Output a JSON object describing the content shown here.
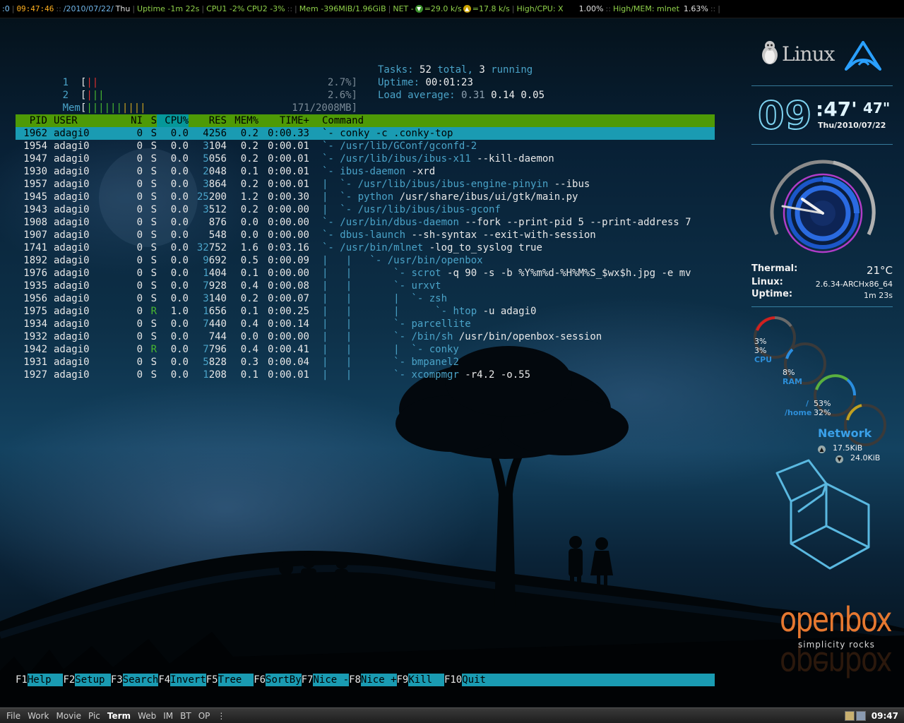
{
  "topbar": {
    "workspace": ":0",
    "time": "09:47:46",
    "date_sep": "::",
    "date": "/2010/07/22/",
    "weekday": "Thu",
    "uptime": "Uptime -1m 22s",
    "sep": "::",
    "cpu1": "CPU1 -2%",
    "cpu2": "CPU2 -3%",
    "mem": "Mem -396MiB/1.96GiB",
    "net_label": "NET -",
    "net_down": "=29.0 k/s",
    "net_up": "=17.8 k/s",
    "high_cpu": "High/CPU: X",
    "high_cpu_val": "1.00%",
    "high_mem": "High/MEM: mlnet",
    "high_mem_val": "1.63%",
    "pipe": "|",
    "seps": "::"
  },
  "htop": {
    "meters": [
      {
        "label": "1",
        "bars_red": "||",
        "bars_green": "",
        "bars_yellow": "",
        "value": "2.7%]"
      },
      {
        "label": "2",
        "bars_red": "|",
        "bars_green": "||",
        "bars_yellow": "",
        "value": "2.6%]"
      },
      {
        "label": "Mem",
        "bars_red": "",
        "bars_green": "||||||",
        "bars_yellow": "||||",
        "value": "171/2008MB]"
      }
    ],
    "tasks": {
      "label": "Tasks:",
      "total": "52",
      "total_lbl": "total,",
      "running": "3",
      "running_lbl": "running"
    },
    "uptime": {
      "label": "Uptime:",
      "value": "00:01:23"
    },
    "load": {
      "label": "Load average:",
      "v1": "0.31",
      "v2": "0.14",
      "v3": "0.05"
    },
    "headers": {
      "pid": "PID",
      "user": "USER",
      "ni": "NI",
      "s": "S",
      "cpu": "CPU%",
      "res": "RES",
      "mem": "MEM%",
      "time": "TIME+",
      "cmd": "Command"
    },
    "rows": [
      {
        "pid": "1962",
        "user": "adagi0",
        "ni": "0",
        "s": "S",
        "cpu": "0.0",
        "res_hi": "",
        "res": "4256",
        "mem": "0.2",
        "time": "0:00.33",
        "tree": "`- ",
        "base": "conky -c .conky-top",
        "rest": ""
      },
      {
        "pid": "1954",
        "user": "adagi0",
        "ni": "0",
        "s": "S",
        "cpu": "0.0",
        "res_hi": "3",
        "res": "104",
        "mem": "0.2",
        "time": "0:00.01",
        "tree": "`- ",
        "base": "/usr/lib/GConf/gconfd-2",
        "rest": ""
      },
      {
        "pid": "1947",
        "user": "adagi0",
        "ni": "0",
        "s": "S",
        "cpu": "0.0",
        "res_hi": "5",
        "res": "056",
        "mem": "0.2",
        "time": "0:00.01",
        "tree": "`- ",
        "base": "/usr/lib/ibus/ibus-x11",
        "rest": " --kill-daemon"
      },
      {
        "pid": "1930",
        "user": "adagi0",
        "ni": "0",
        "s": "S",
        "cpu": "0.0",
        "res_hi": "2",
        "res": "048",
        "mem": "0.1",
        "time": "0:00.01",
        "tree": "`- ",
        "base": "ibus-daemon",
        "rest": " -xrd"
      },
      {
        "pid": "1957",
        "user": "adagi0",
        "ni": "0",
        "s": "S",
        "cpu": "0.0",
        "res_hi": "3",
        "res": "864",
        "mem": "0.2",
        "time": "0:00.01",
        "tree": "|  `- ",
        "base": "/usr/lib/ibus/ibus-engine-pinyin",
        "rest": " --ibus"
      },
      {
        "pid": "1945",
        "user": "adagi0",
        "ni": "0",
        "s": "S",
        "cpu": "0.0",
        "res_hi": "25",
        "res": "200",
        "mem": "1.2",
        "time": "0:00.30",
        "tree": "|  `- ",
        "base": "python",
        "rest": " /usr/share/ibus/ui/gtk/main.py"
      },
      {
        "pid": "1943",
        "user": "adagi0",
        "ni": "0",
        "s": "S",
        "cpu": "0.0",
        "res_hi": "3",
        "res": "512",
        "mem": "0.2",
        "time": "0:00.00",
        "tree": "|  `- ",
        "base": "/usr/lib/ibus/ibus-gconf",
        "rest": ""
      },
      {
        "pid": "1908",
        "user": "adagi0",
        "ni": "0",
        "s": "S",
        "cpu": "0.0",
        "res_hi": "",
        "res": "876",
        "mem": "0.0",
        "time": "0:00.00",
        "tree": "`- ",
        "base": "/usr/bin/dbus-daemon",
        "rest": " --fork --print-pid 5 --print-address 7"
      },
      {
        "pid": "1907",
        "user": "adagi0",
        "ni": "0",
        "s": "S",
        "cpu": "0.0",
        "res_hi": "",
        "res": "548",
        "mem": "0.0",
        "time": "0:00.00",
        "tree": "`- ",
        "base": "dbus-launch",
        "rest": " --sh-syntax --exit-with-session"
      },
      {
        "pid": "1741",
        "user": "adagi0",
        "ni": "0",
        "s": "S",
        "cpu": "0.0",
        "res_hi": "32",
        "res": "752",
        "mem": "1.6",
        "time": "0:03.16",
        "tree": "`- ",
        "base": "/usr/bin/mlnet",
        "rest": " -log_to_syslog true"
      },
      {
        "pid": "1892",
        "user": "adagi0",
        "ni": "0",
        "s": "S",
        "cpu": "0.0",
        "res_hi": "9",
        "res": "692",
        "mem": "0.5",
        "time": "0:00.09",
        "tree": "|   |   `- ",
        "base": "/usr/bin/openbox",
        "rest": ""
      },
      {
        "pid": "1976",
        "user": "adagi0",
        "ni": "0",
        "s": "S",
        "cpu": "0.0",
        "res_hi": "1",
        "res": "404",
        "mem": "0.1",
        "time": "0:00.00",
        "tree": "|   |       `- ",
        "base": "scrot",
        "rest": " -q 90 -s -b %Y%m%d-%H%M%S_$wx$h.jpg -e mv"
      },
      {
        "pid": "1935",
        "user": "adagi0",
        "ni": "0",
        "s": "S",
        "cpu": "0.0",
        "res_hi": "7",
        "res": "928",
        "mem": "0.4",
        "time": "0:00.08",
        "tree": "|   |       `- ",
        "base": "urxvt",
        "rest": ""
      },
      {
        "pid": "1956",
        "user": "adagi0",
        "ni": "0",
        "s": "S",
        "cpu": "0.0",
        "res_hi": "3",
        "res": "140",
        "mem": "0.2",
        "time": "0:00.07",
        "tree": "|   |       |  `- ",
        "base": "zsh",
        "rest": ""
      },
      {
        "pid": "1975",
        "user": "adagi0",
        "ni": "0",
        "s": "R",
        "cpu": "1.0",
        "res_hi": "1",
        "res": "656",
        "mem": "0.1",
        "time": "0:00.25",
        "tree": "|   |       |      `- ",
        "base": "htop",
        "rest": " -u adagi0"
      },
      {
        "pid": "1934",
        "user": "adagi0",
        "ni": "0",
        "s": "S",
        "cpu": "0.0",
        "res_hi": "7",
        "res": "440",
        "mem": "0.4",
        "time": "0:00.14",
        "tree": "|   |       `- ",
        "base": "parcellite",
        "rest": ""
      },
      {
        "pid": "1932",
        "user": "adagi0",
        "ni": "0",
        "s": "S",
        "cpu": "0.0",
        "res_hi": "",
        "res": "744",
        "mem": "0.0",
        "time": "0:00.00",
        "tree": "|   |       `- ",
        "base": "/bin/sh",
        "rest": " /usr/bin/openbox-session"
      },
      {
        "pid": "1942",
        "user": "adagi0",
        "ni": "0",
        "s": "R",
        "cpu": "0.0",
        "res_hi": "7",
        "res": "796",
        "mem": "0.4",
        "time": "0:00.41",
        "tree": "|   |       |  `- ",
        "base": "conky",
        "rest": ""
      },
      {
        "pid": "1931",
        "user": "adagi0",
        "ni": "0",
        "s": "S",
        "cpu": "0.0",
        "res_hi": "5",
        "res": "828",
        "mem": "0.3",
        "time": "0:00.04",
        "tree": "|   |       `- ",
        "base": "bmpanel2",
        "rest": ""
      },
      {
        "pid": "1927",
        "user": "adagi0",
        "ni": "0",
        "s": "S",
        "cpu": "0.0",
        "res_hi": "1",
        "res": "208",
        "mem": "0.1",
        "time": "0:00.01",
        "tree": "|   |       `- ",
        "base": "xcompmgr",
        "rest": " -r4.2 -o.55"
      }
    ],
    "fkeys": [
      {
        "key": "F1",
        "label": "Help  "
      },
      {
        "key": "F2",
        "label": "Setup "
      },
      {
        "key": "F3",
        "label": "Search"
      },
      {
        "key": "F4",
        "label": "Invert"
      },
      {
        "key": "F5",
        "label": "Tree  "
      },
      {
        "key": "F6",
        "label": "SortBy"
      },
      {
        "key": "F7",
        "label": "Nice -"
      },
      {
        "key": "F8",
        "label": "Nice +"
      },
      {
        "key": "F9",
        "label": "Kill  "
      },
      {
        "key": "F10",
        "label": "Quit"
      }
    ]
  },
  "conky": {
    "linux_logo": "Linux",
    "clock": {
      "hours": "09",
      "minutes": ":47'",
      "seconds": "47\"",
      "date": "Thu/2010/07/22"
    },
    "thermal_label": "Thermal:",
    "thermal_value": "21°C",
    "linux_label": "Linux:",
    "linux_value": "2.6.34-ARCHx86_64",
    "uptime_label": "Uptime:",
    "uptime_value": "1m 23s",
    "cpu_a": "3%",
    "cpu_b": "3%",
    "cpu_label": "CPU",
    "ram_value": "8%",
    "ram_label": "RAM",
    "root_label": "/",
    "root_value": "53%",
    "home_label": "/home",
    "home_value": "32%",
    "network_title": "Network",
    "net_up": "17.5KiB",
    "net_down": "24.0KiB",
    "openbox": "openbox",
    "openbox_sub": "simplicity rocks"
  },
  "taskbar": {
    "items": [
      "File",
      "Work",
      "Movie",
      "Pic",
      "Term",
      "Web",
      "IM",
      "BT",
      "OP"
    ],
    "active": "Term",
    "dots": "⋮",
    "clock": "09:47"
  },
  "colors": {
    "terminal_cyan": "#1a9bb2",
    "header_green": "#4e9a06",
    "clock_orange": "#ffb020",
    "openbox_orange": "#e67830"
  }
}
